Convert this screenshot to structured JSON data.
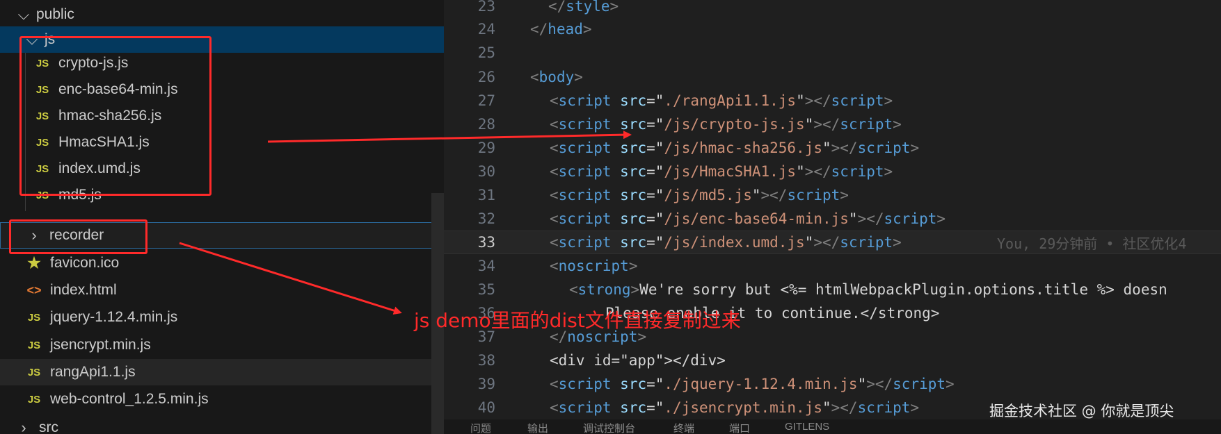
{
  "explorer": {
    "items": [
      {
        "label": "public",
        "type": "folder",
        "expanded": true
      },
      {
        "label": "js",
        "type": "folder",
        "expanded": true
      },
      {
        "label": "crypto-js.js",
        "type": "js"
      },
      {
        "label": "enc-base64-min.js",
        "type": "js"
      },
      {
        "label": "hmac-sha256.js",
        "type": "js"
      },
      {
        "label": "HmacSHA1.js",
        "type": "js"
      },
      {
        "label": "index.umd.js",
        "type": "js"
      },
      {
        "label": "md5.js",
        "type": "js"
      },
      {
        "label": "recorder",
        "type": "folder",
        "expanded": false
      },
      {
        "label": "favicon.ico",
        "type": "favicon"
      },
      {
        "label": "index.html",
        "type": "html"
      },
      {
        "label": "jquery-1.12.4.min.js",
        "type": "js"
      },
      {
        "label": "jsencrypt.min.js",
        "type": "js"
      },
      {
        "label": "rangApi1.1.js",
        "type": "js"
      },
      {
        "label": "web-control_1.2.5.min.js",
        "type": "js"
      },
      {
        "label": "src",
        "type": "folder",
        "expanded": false
      }
    ],
    "js_icon_text": "JS",
    "star_icon": "★",
    "html_icon": "<>",
    "chev_down": "⌵",
    "chev_right": "›"
  },
  "editor": {
    "lines": [
      {
        "n": "23",
        "code": "</style>"
      },
      {
        "n": "24",
        "code": "</head>"
      },
      {
        "n": "25",
        "code": ""
      },
      {
        "n": "26",
        "code": "<body>"
      },
      {
        "n": "27",
        "src": "./rangApi1.1.js"
      },
      {
        "n": "28",
        "src": "/js/crypto-js.js"
      },
      {
        "n": "29",
        "src": "/js/hmac-sha256.js"
      },
      {
        "n": "30",
        "src": "/js/HmacSHA1.js"
      },
      {
        "n": "31",
        "src": "/js/md5.js"
      },
      {
        "n": "32",
        "src": "/js/enc-base64-min.js"
      },
      {
        "n": "33",
        "src": "/js/index.umd.js"
      },
      {
        "n": "34",
        "code": "<noscript>"
      },
      {
        "n": "35",
        "code": "We're sorry but <%= htmlWebpackPlugin.options.title %> doesn"
      },
      {
        "n": "36",
        "code": "Please enable it to continue.</strong>"
      },
      {
        "n": "37",
        "code": "</noscript>"
      },
      {
        "n": "38",
        "code": "<div id=\"app\"></div>"
      },
      {
        "n": "39",
        "src": "./jquery-1.12.4.min.js"
      },
      {
        "n": "40",
        "src": "./jsencrypt.min.js"
      }
    ],
    "blame": "You, 29分钟前 • 社区优化4",
    "panel_tabs": [
      "问题",
      "输出",
      "调试控制台",
      "终端",
      "端口",
      "GITLENS"
    ]
  },
  "annotation": {
    "text": "js demo里面的dist文件直接复制过来",
    "color": "#ff2a2a"
  },
  "watermark": "掘金技术社区 @ 你就是顶尖"
}
